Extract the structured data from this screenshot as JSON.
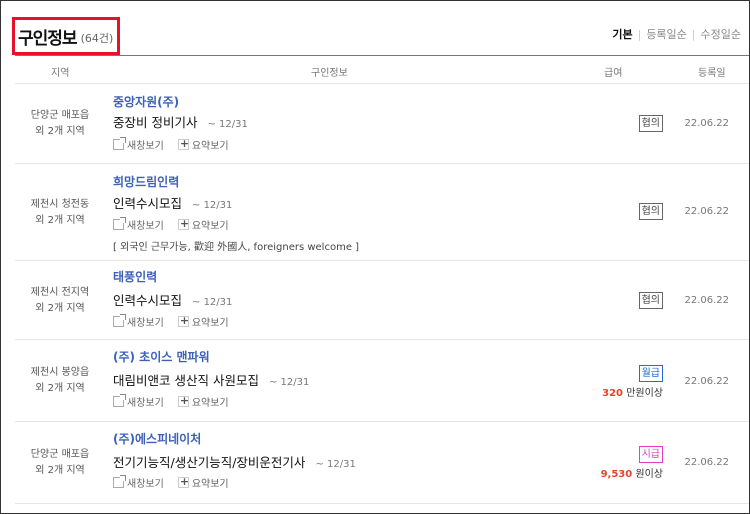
{
  "header": {
    "title": "구인정보",
    "count": "(64건)",
    "sort": [
      "기본",
      "등록일순",
      "수정일순"
    ]
  },
  "columns": [
    "지역",
    "구인정보",
    "급여",
    "등록일"
  ],
  "actions": {
    "new_window": "새창보기",
    "summary": "요약보기"
  },
  "jobs": [
    {
      "location_1": "단양군 매포읍",
      "location_2": "외 2개 지역",
      "company": "중앙자원(주)",
      "title": "중장비 정비기사",
      "deadline": "~ 12/31",
      "tags": "",
      "pay_type": "협의",
      "pay_amount": "",
      "pay_unit": "",
      "date": "22.06.22"
    },
    {
      "location_1": "제천시 청전동",
      "location_2": "외 2개 지역",
      "company": "희망드림인력",
      "title": "인력수시모집",
      "deadline": "~ 12/31",
      "tags": "[ 외국인 근무가능, 歡迎 外國人, foreigners welcome ]",
      "pay_type": "협의",
      "pay_amount": "",
      "pay_unit": "",
      "date": "22.06.22"
    },
    {
      "location_1": "제천시 전지역",
      "location_2": "외 2개 지역",
      "company": "태풍인력",
      "title": "인력수시모집",
      "deadline": "~ 12/31",
      "tags": "",
      "pay_type": "협의",
      "pay_amount": "",
      "pay_unit": "",
      "date": "22.06.22"
    },
    {
      "location_1": "제천시 봉양읍",
      "location_2": "외 2개 지역",
      "company": "(주) 초이스 맨파워",
      "title": "대림비앤코 생산직 사원모집",
      "deadline": "~ 12/31",
      "tags": "",
      "pay_type": "월급",
      "pay_amount": "320",
      "pay_unit": "만원이상",
      "date": "22.06.22"
    },
    {
      "location_1": "단양군 매포읍",
      "location_2": "외 2개 지역",
      "company": "(주)에스피네이처",
      "title": "전기기능직/생산기능직/장비운전기사",
      "deadline": "~ 12/31",
      "tags": "",
      "pay_type": "시급",
      "pay_amount": "9,530",
      "pay_unit": "원이상",
      "date": "22.06.22"
    }
  ]
}
